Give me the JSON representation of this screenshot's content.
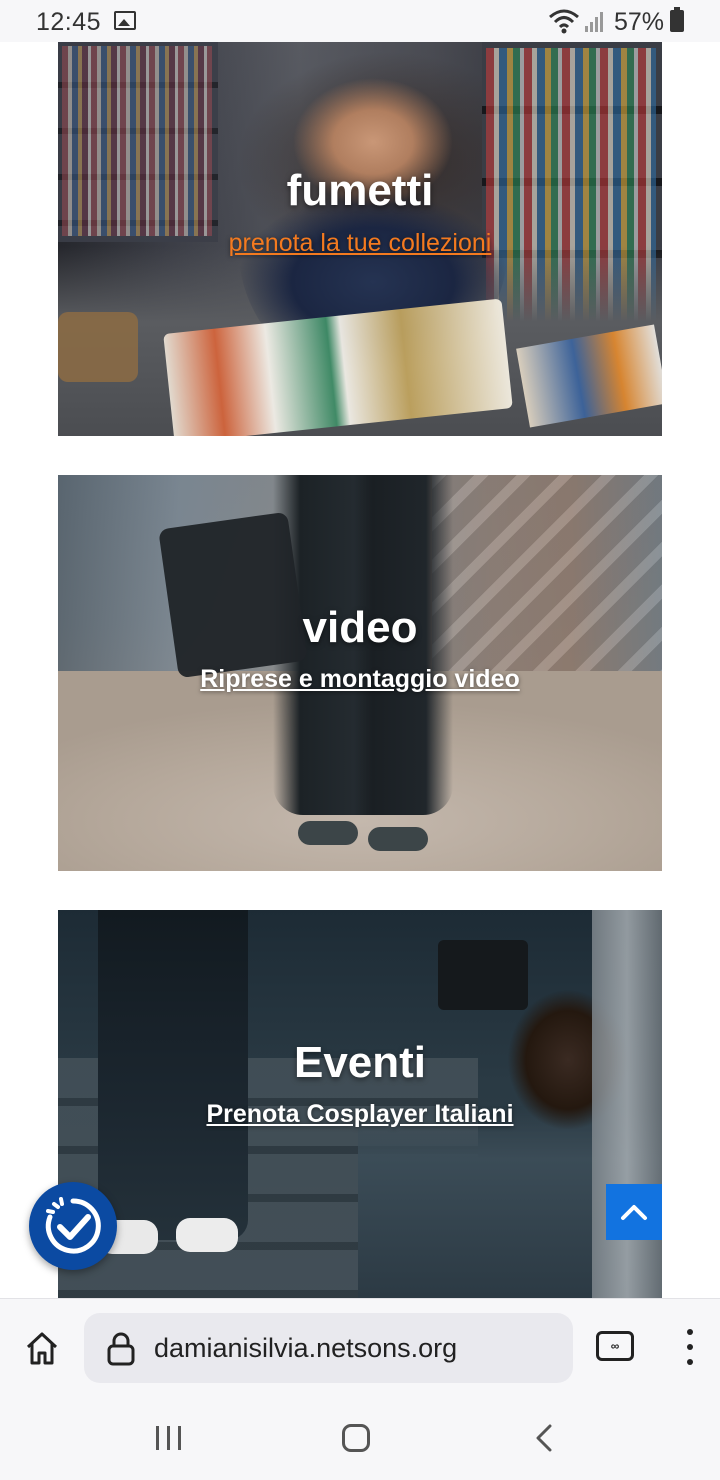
{
  "status_bar": {
    "time": "12:45",
    "battery": "57%",
    "icons": [
      "gallery-icon",
      "wifi-icon",
      "signal-icon",
      "battery-icon"
    ]
  },
  "cards": [
    {
      "title": "fumetti",
      "link": "prenota la tue collezioni",
      "link_color": "#f47a1f"
    },
    {
      "title": "video",
      "link": "Riprese e montaggio video",
      "link_color": "#ffffff"
    },
    {
      "title": "Eventi",
      "link": "Prenota Cosplayer Italiani",
      "link_color": "#ffffff"
    }
  ],
  "floating": {
    "accessibility_icon": "accessibility-check-icon",
    "scroll_top_icon": "chevron-up-icon",
    "accessibility_color": "#0b4aa2",
    "scroll_top_color": "#1273e0"
  },
  "browser": {
    "url": "damianisilvia.netsons.org",
    "tab_badge": "∞",
    "icons": [
      "home-icon",
      "lock-icon",
      "tabs-icon",
      "more-vert-icon"
    ]
  },
  "nav_bar": {
    "icons": [
      "recents-icon",
      "home-circle-icon",
      "back-icon"
    ]
  }
}
